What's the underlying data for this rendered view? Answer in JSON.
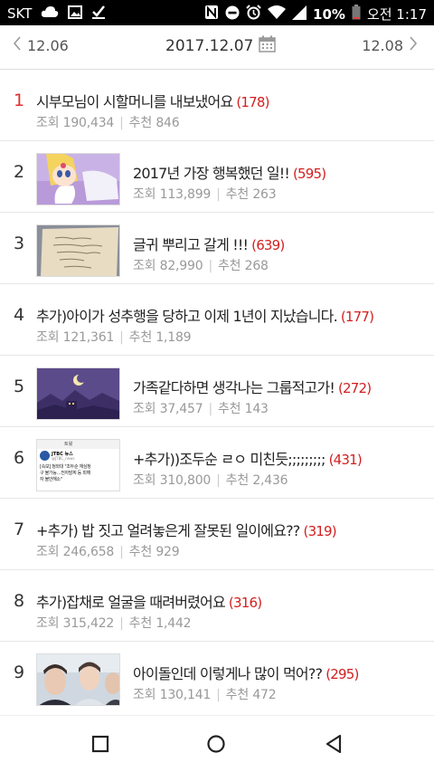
{
  "status_bar": {
    "carrier": "SKT",
    "battery": "10%",
    "time": "오전 1:17",
    "left_icons": [
      "cloud-icon",
      "image-icon",
      "check-download-icon"
    ],
    "right_icons": [
      "nfc-icon",
      "minus-circle-icon",
      "alarm-icon",
      "wifi-icon",
      "signal-icon",
      "battery-icon"
    ]
  },
  "date_nav": {
    "prev": "12.06",
    "current": "2017.12.07",
    "next": "12.08"
  },
  "colors": {
    "rank_top": "#e03030",
    "comment_count": "#d32020"
  },
  "labels": {
    "views": "조회",
    "recommend": "추천"
  },
  "posts": [
    {
      "rank": "1",
      "title": "시부모님이 시할머니를 내보냈어요",
      "comments": "(178)",
      "views": "190,434",
      "recs": "846",
      "thumb": null
    },
    {
      "rank": "2",
      "title": "2017년 가장 행복했던 일!!",
      "comments": "(595)",
      "views": "113,899",
      "recs": "263",
      "thumb": "anime-girl"
    },
    {
      "rank": "3",
      "title": "글귀 뿌리고 갈게 !!!",
      "comments": "(639)",
      "views": "82,990",
      "recs": "268",
      "thumb": "handwritten-note"
    },
    {
      "rank": "4",
      "title": "추가)아이가 성추행을 당하고 이제 1년이 지났습니다.",
      "comments": "(177)",
      "views": "121,361",
      "recs": "1,189",
      "thumb": null
    },
    {
      "rank": "5",
      "title": "가족같다하면 생각나는 그룹적고가!",
      "comments": "(272)",
      "views": "37,457",
      "recs": "143",
      "thumb": "night-sky"
    },
    {
      "rank": "6",
      "title": "+추가))조두순 ㄹㅇ 미친듯;;;;;;;;;",
      "comments": "(431)",
      "views": "310,800",
      "recs": "2,436",
      "thumb": "tweet",
      "thumb_text": {
        "header": "트윗",
        "account": "JTBC 뉴스",
        "handle": "@JTBC_news",
        "body": "[속보] 청와대 \"조두순 재심청구 불가능…전자발찌 등 피해자 불안해소\""
      }
    },
    {
      "rank": "7",
      "title": "+추가) 밥 짓고 얼려놓은게 잘못된 일이에요??",
      "comments": "(319)",
      "views": "246,658",
      "recs": "929",
      "thumb": null
    },
    {
      "rank": "8",
      "title": "추가)잡채로 얼굴을 때려버렸어요",
      "comments": "(316)",
      "views": "315,422",
      "recs": "1,442",
      "thumb": null
    },
    {
      "rank": "9",
      "title": "아이돌인데 이렇게나 많이 먹어??",
      "comments": "(295)",
      "views": "130,141",
      "recs": "472",
      "thumb": "idol-photo"
    }
  ],
  "nav_bar": [
    "recent-apps-icon",
    "home-icon",
    "back-icon"
  ]
}
